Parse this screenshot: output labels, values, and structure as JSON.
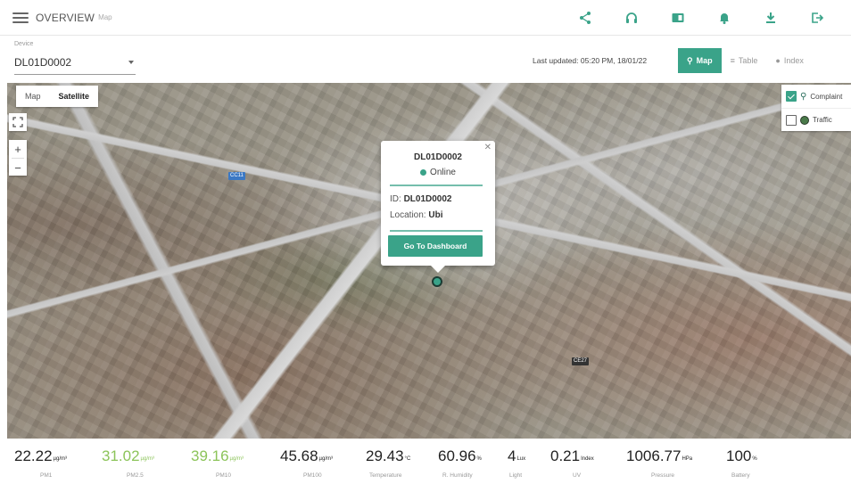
{
  "header": {
    "title": "OVERVIEW",
    "subtitle": "Map",
    "icons": [
      "share-icon",
      "headset-icon",
      "panel-icon",
      "bell-icon",
      "download-icon",
      "logout-icon"
    ]
  },
  "filter": {
    "device_label": "Device",
    "device_value": "DL01D0002",
    "last_updated": "Last updated: 05:20 PM, 18/01/22",
    "tabs": [
      {
        "label": "Map",
        "icon": "map-pin-icon",
        "active": true
      },
      {
        "label": "Table",
        "icon": "table-icon",
        "active": false
      },
      {
        "label": "Index",
        "icon": "index-icon",
        "active": false
      }
    ]
  },
  "map": {
    "type_buttons": [
      "Map",
      "Satellite"
    ],
    "active_type": "Satellite",
    "layers": [
      {
        "label": "Complaint",
        "checked": true
      },
      {
        "label": "Traffic",
        "checked": false
      }
    ],
    "road_tags": [
      "CC11",
      "CE27"
    ],
    "popup": {
      "title": "DL01D0002",
      "status": "Online",
      "id_label": "ID:",
      "id_value": "DL01D0002",
      "location_label": "Location:",
      "location_value": "Ubi",
      "button": "Go To Dashboard"
    }
  },
  "metrics": [
    {
      "value": "22.22",
      "unit": "µg/m³",
      "label": "PM1",
      "color": "#222222"
    },
    {
      "value": "31.02",
      "unit": "µg/m³",
      "label": "PM2.5",
      "color": "#8cc45a"
    },
    {
      "value": "39.16",
      "unit": "µg/m³",
      "label": "PM10",
      "color": "#8cc45a"
    },
    {
      "value": "45.68",
      "unit": "µg/m³",
      "label": "PM100",
      "color": "#222222"
    },
    {
      "value": "29.43",
      "unit": "°C",
      "label": "Temperature",
      "color": "#222222"
    },
    {
      "value": "60.96",
      "unit": "%",
      "label": "R. Humidity",
      "color": "#222222"
    },
    {
      "value": "4",
      "unit": "Lux",
      "label": "Light",
      "color": "#222222"
    },
    {
      "value": "0.21",
      "unit": "Index",
      "label": "UV",
      "color": "#222222"
    },
    {
      "value": "1006.77",
      "unit": "HPa",
      "label": "Pressure",
      "color": "#222222"
    },
    {
      "value": "100",
      "unit": "%",
      "label": "Battery",
      "color": "#222222"
    }
  ],
  "colors": {
    "accent": "#3aa389",
    "good": "#8cc45a"
  }
}
